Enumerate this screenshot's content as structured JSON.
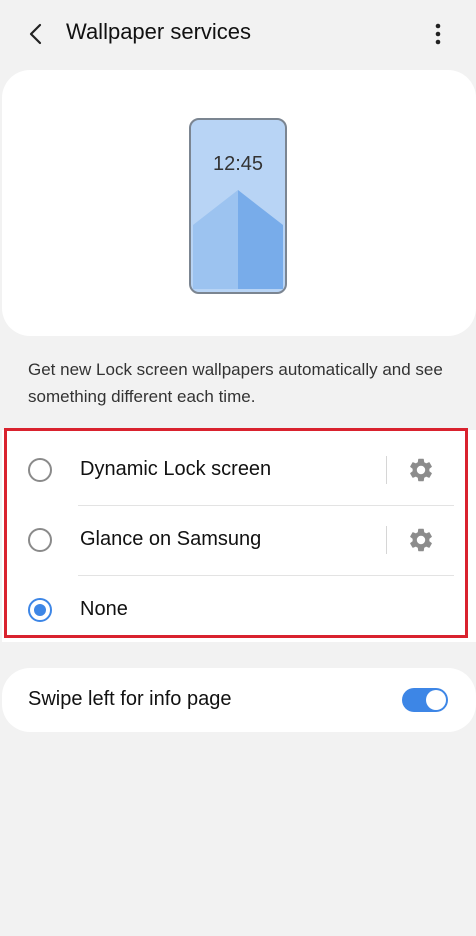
{
  "header": {
    "title": "Wallpaper services",
    "back_icon": "chevron-left-icon",
    "more_icon": "more-vert-icon"
  },
  "preview": {
    "clock_time": "12:45"
  },
  "description": "Get new Lock screen wallpapers automatically and see something different each time.",
  "options": [
    {
      "label": "Dynamic Lock screen",
      "selected": false,
      "has_settings": true
    },
    {
      "label": "Glance on Samsung",
      "selected": false,
      "has_settings": true
    },
    {
      "label": "None",
      "selected": true,
      "has_settings": false
    }
  ],
  "swipe": {
    "label": "Swipe left for info page",
    "enabled": true
  },
  "colors": {
    "accent": "#3d86e6",
    "highlight_border": "#d9222e",
    "background": "#f2f2f2"
  }
}
